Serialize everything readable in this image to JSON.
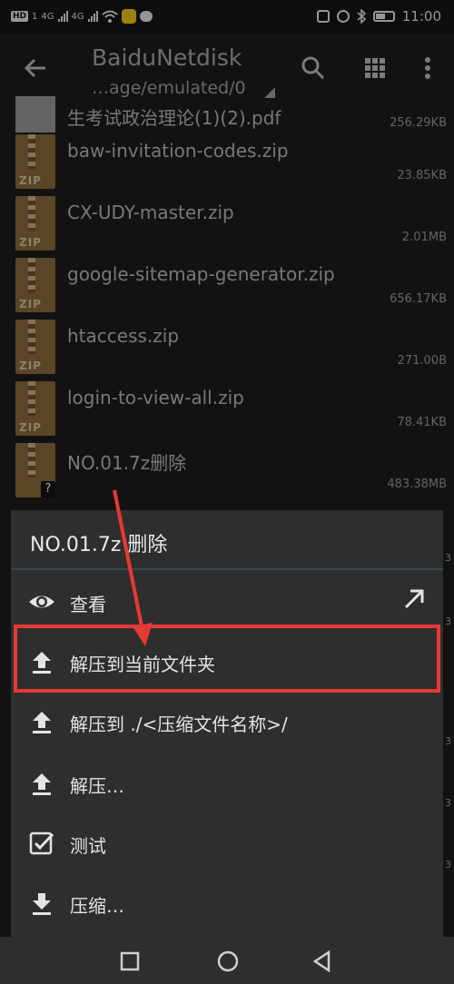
{
  "status_bar": {
    "left_chip": "HD",
    "left_small": "1",
    "net1": "4G",
    "net2": "4G",
    "time": "11:00"
  },
  "toolbar": {
    "title": "BaiduNetdisk",
    "path": "…age/emulated/0",
    "icons": [
      "back-arrow-icon",
      "search-icon",
      "grid-view-icon",
      "more-vertical-icon"
    ]
  },
  "files": [
    {
      "name": "生考试政治理论(1)(2).pdf",
      "size": "256.29KB",
      "type": "pdf"
    },
    {
      "name": "baw-invitation-codes.zip",
      "size": "23.85KB",
      "type": "zip"
    },
    {
      "name": "CX-UDY-master.zip",
      "size": "2.01MB",
      "type": "zip"
    },
    {
      "name": "google-sitemap-generator.zip",
      "size": "656.17KB",
      "type": "zip"
    },
    {
      "name": "htaccess.zip",
      "size": "271.00B",
      "type": "zip"
    },
    {
      "name": "login-to-view-all.zip",
      "size": "78.41KB",
      "type": "zip"
    },
    {
      "name": "NO.01.7z删除",
      "size": "483.38MB",
      "type": "unknown"
    }
  ],
  "zip_label": "ZIP",
  "unknown_badge": "?",
  "sheet": {
    "title": "NO.01.7z 删除",
    "items": [
      {
        "label": "查看",
        "icon": "eye-icon",
        "trailing": "open-external-icon"
      },
      {
        "label": "解压到当前文件夹",
        "icon": "upload-icon"
      },
      {
        "label": "解压到 ./<压缩文件名称>/",
        "icon": "upload-icon"
      },
      {
        "label": "解压…",
        "icon": "upload-icon"
      },
      {
        "label": "测试",
        "icon": "checkbox-icon"
      },
      {
        "label": "压缩…",
        "icon": "download-icon"
      }
    ],
    "highlighted_item": "解压到当前文件夹"
  },
  "annotation_color": "#e53935",
  "nav_bar": [
    "recent-apps-icon",
    "home-icon",
    "back-icon"
  ]
}
